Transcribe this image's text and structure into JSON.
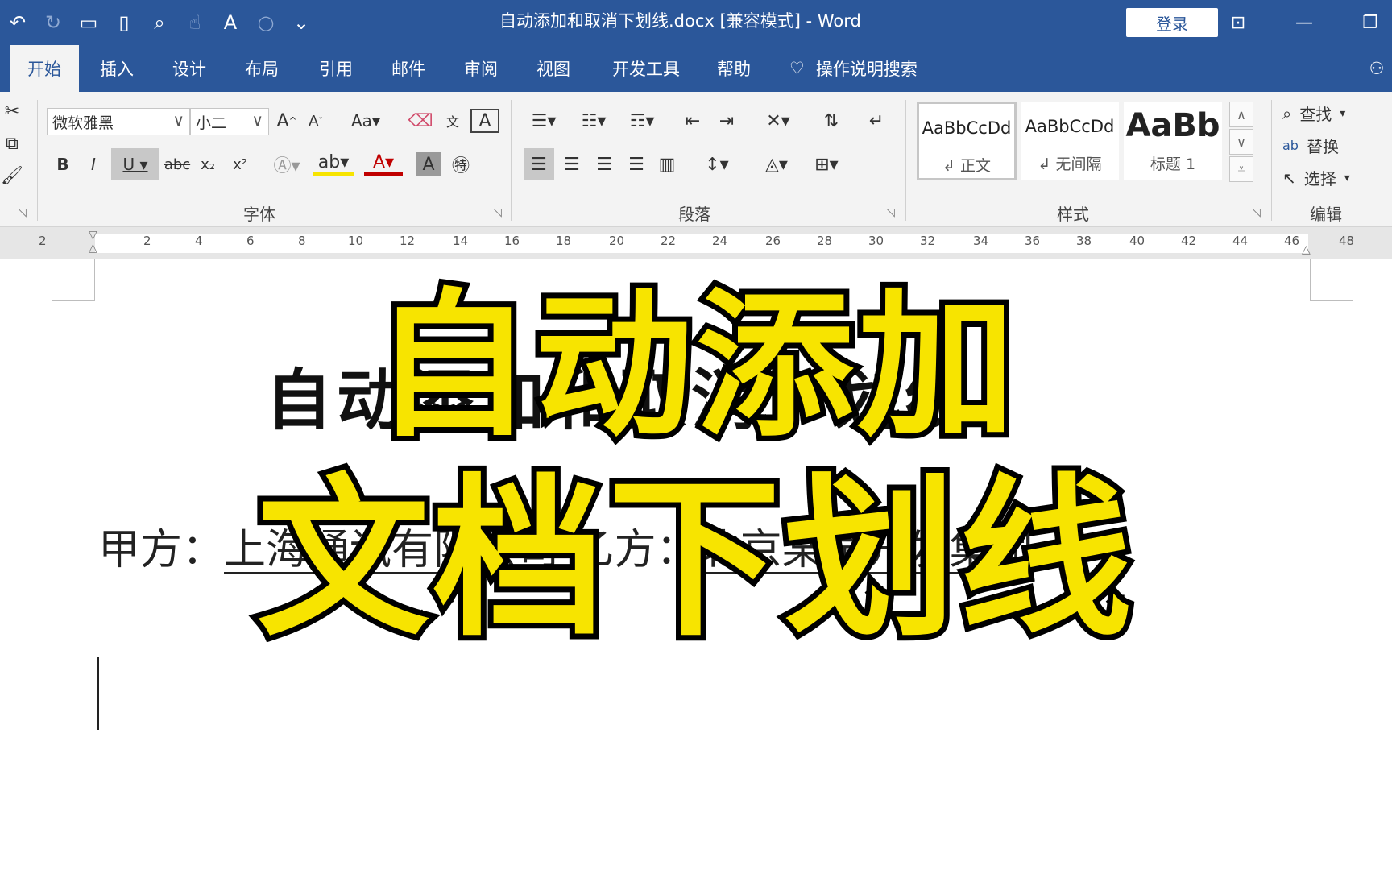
{
  "titlebar": {
    "qat_icons": [
      "undo-icon",
      "redo-icon",
      "open-icon",
      "new-icon",
      "print-preview-icon",
      "touch-mode-icon",
      "read-aloud-icon",
      "circle-icon",
      "customize-qat-icon"
    ],
    "title": "自动添加和取消下划线.docx [兼容模式]  -  Word",
    "login_label": "登录",
    "ribbon_display_icon": "ribbon-display-icon",
    "minimize_icon": "minimize-icon",
    "restore_icon": "restore-icon"
  },
  "tabs": [
    "开始",
    "插入",
    "设计",
    "布局",
    "引用",
    "邮件",
    "审阅",
    "视图",
    "开发工具",
    "帮助"
  ],
  "active_tab": "开始",
  "tell_me": "操作说明搜索",
  "ribbon": {
    "font": {
      "font_name": "微软雅黑",
      "font_size": "小二",
      "group_label": "字体"
    },
    "paragraph": {
      "group_label": "段落"
    },
    "styles": {
      "group_label": "样式",
      "items": [
        {
          "sample": "AaBbCcDd",
          "name": "↲ 正文"
        },
        {
          "sample": "AaBbCcDd",
          "name": "↲ 无间隔"
        },
        {
          "sample": "AaBb",
          "name": "标题 1"
        }
      ]
    },
    "editing": {
      "group_label": "编辑",
      "find": "查找",
      "replace": "替换",
      "select": "选择"
    }
  },
  "ruler": {
    "numbers": [
      "2",
      "2",
      "4",
      "6",
      "8",
      "10",
      "12",
      "14",
      "16",
      "18",
      "20",
      "22",
      "24",
      "26",
      "28",
      "30",
      "32",
      "34",
      "36",
      "38",
      "40",
      "42",
      "44",
      "46",
      "48"
    ]
  },
  "document": {
    "heading": "自动添加和取消下划线",
    "line_prefix": "甲方：",
    "line_party_a": "上海通讯有限公司",
    "line_gap": "  乙方：",
    "line_party_b": "北京某某开发集团"
  },
  "overlay": {
    "line1": "自动添加",
    "line2": "文档下划线"
  }
}
